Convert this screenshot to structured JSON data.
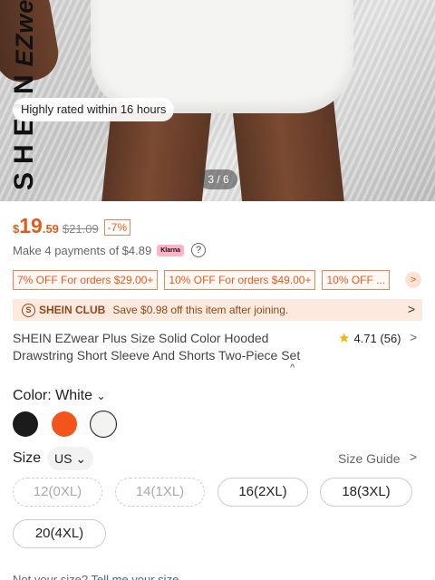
{
  "hero": {
    "brand_main": "SHEIN",
    "brand_sub": "EZwear",
    "rated_badge": "Highly rated within 16 hours",
    "page_counter": "3 / 6"
  },
  "price": {
    "currency": "$",
    "integer": "19",
    "decimal": ".59",
    "original": "$21.09",
    "discount": "-7%"
  },
  "klarna": {
    "text": "Make 4 payments of $4.89",
    "badge": "Klarna",
    "help": "?"
  },
  "coupons": [
    "7% OFF For orders $29.00+",
    "10% OFF For orders $49.00+",
    "10% OFF ..."
  ],
  "coupon_more": ">",
  "club": {
    "icon": "S",
    "label": "SHEIN CLUB",
    "text": "Save $0.98 off this item after joining.",
    "chevron": ">"
  },
  "product": {
    "title": "SHEIN EZwear Plus Size Solid Color Hooded Drawstring Short Sleeve And Shorts Two-Piece Set",
    "collapse": "^",
    "rating": "4.71",
    "reviews": "(56)",
    "star": "★",
    "chevron": ">"
  },
  "color": {
    "label": "Color: White",
    "caret": "⌄",
    "swatches": [
      {
        "name": "Black",
        "hex": "#1b1b1b"
      },
      {
        "name": "Orange",
        "hex": "#f2541b"
      },
      {
        "name": "White",
        "hex": "#f3f3f1"
      }
    ],
    "selected_index": 2
  },
  "size": {
    "label": "Size",
    "unit": "US ⌄",
    "guide": "Size Guide",
    "guide_chevron": ">",
    "options": [
      {
        "label": "12(0XL)",
        "available": false
      },
      {
        "label": "14(1XL)",
        "available": false
      },
      {
        "label": "16(2XL)",
        "available": true
      },
      {
        "label": "18(3XL)",
        "available": true
      },
      {
        "label": "20(4XL)",
        "available": true
      }
    ]
  },
  "footer": {
    "hint": "Not your size?",
    "link": "Tell me your size"
  }
}
